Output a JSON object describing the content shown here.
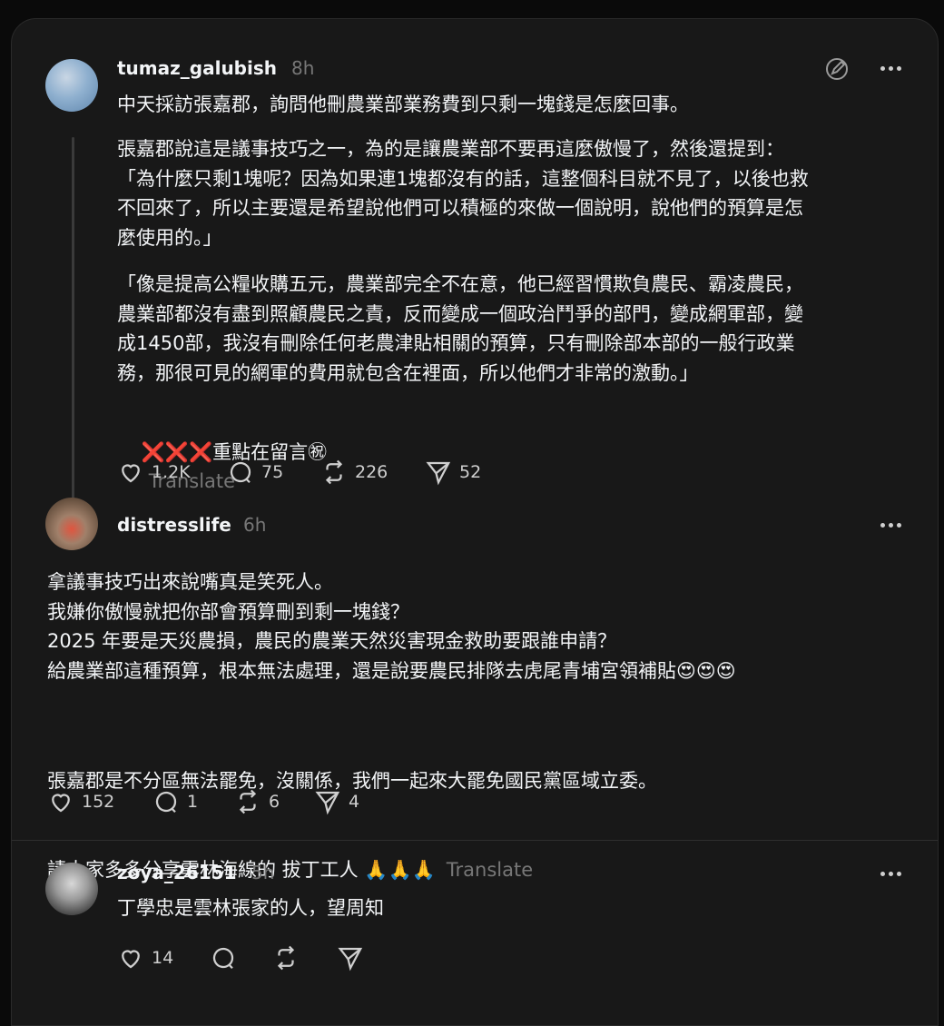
{
  "posts": [
    {
      "username": "tumaz_galubish",
      "time": "8h",
      "paragraphs": [
        "中天採訪張嘉郡，詢問他刪農業部業務費到只剩一塊錢是怎麼回事。",
        "張嘉郡說這是議事技巧之一，為的是讓農業部不要再這麼傲慢了，然後還提到：\n「為什麼只剩1塊呢？因為如果連1塊都沒有的話，這整個科目就不見了，以後也救\n不回來了，所以主要還是希望說他們可以積極的來做一個說明，說他們的預算是怎\n麼使用的。」",
        "「像是提高公糧收購五元，農業部完全不在意，他已經習慣欺負農民、霸凌農民，\n農業部都沒有盡到照顧農民之責，反而變成一個政治鬥爭的部門，變成網軍部，變\n成1450部，我沒有刪除任何老農津貼相關的預算，只有刪除部本部的一般行政業\n務，那很可見的網軍的費用就包含在裡面，所以他們才非常的激動。」"
      ],
      "last_line_emoji": "❌❌❌",
      "last_line_text": "重點在留言㊗",
      "translate": "Translate",
      "likes": "1.2K",
      "replies": "75",
      "reposts": "226",
      "shares": "52"
    },
    {
      "username": "distresslife",
      "time": "6h",
      "paragraph1": "拿議事技巧出來說嘴真是笑死人。\n我嫌你傲慢就把你部會預算刪到剩一塊錢？\n2025 年要是天災農損，農民的農業天然災害現金救助要跟誰申請？\n給農業部這種預算，根本無法處理，還是說要農民排隊去虎尾青埔宮領補貼😍😍😍",
      "paragraph2_line1": "張嘉郡是不分區無法罷免，沒關係，我們一起來大罷免國民黨區域立委。",
      "paragraph2_line2": "請大家多多分享雲林海線的 拔丁工人 🙏🙏🙏",
      "translate": "Translate",
      "likes": "152",
      "replies": "1",
      "reposts": "6",
      "shares": "4"
    },
    {
      "username": "zoya_26151",
      "time": "5h",
      "text": "丁學忠是雲林張家的人，望周知",
      "likes": "14"
    }
  ]
}
